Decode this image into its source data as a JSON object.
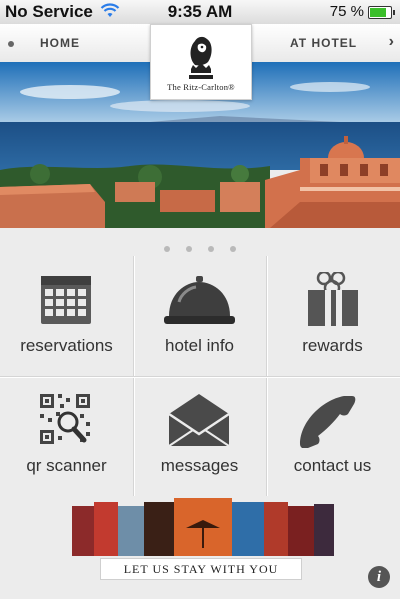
{
  "status_bar": {
    "carrier": "No Service",
    "time": "9:35 AM",
    "battery": "75 %"
  },
  "nav": {
    "home": "HOME",
    "at_hotel": "AT HOTEL"
  },
  "brand": {
    "name": "The Ritz-Carlton®"
  },
  "hero": {
    "page_count": 4,
    "current_page": 1
  },
  "menu": {
    "reservations": "reservations",
    "hotel_info": "hotel info",
    "rewards": "rewards",
    "qr_scanner": "qr scanner",
    "messages": "messages",
    "contact_us": "contact us"
  },
  "banner": {
    "caption": "LET US STAY WITH YOU"
  },
  "info": {
    "glyph": "i"
  },
  "colors": {
    "icon_gray": "#5a5a5a",
    "battery_green": "#3bbf2b"
  }
}
